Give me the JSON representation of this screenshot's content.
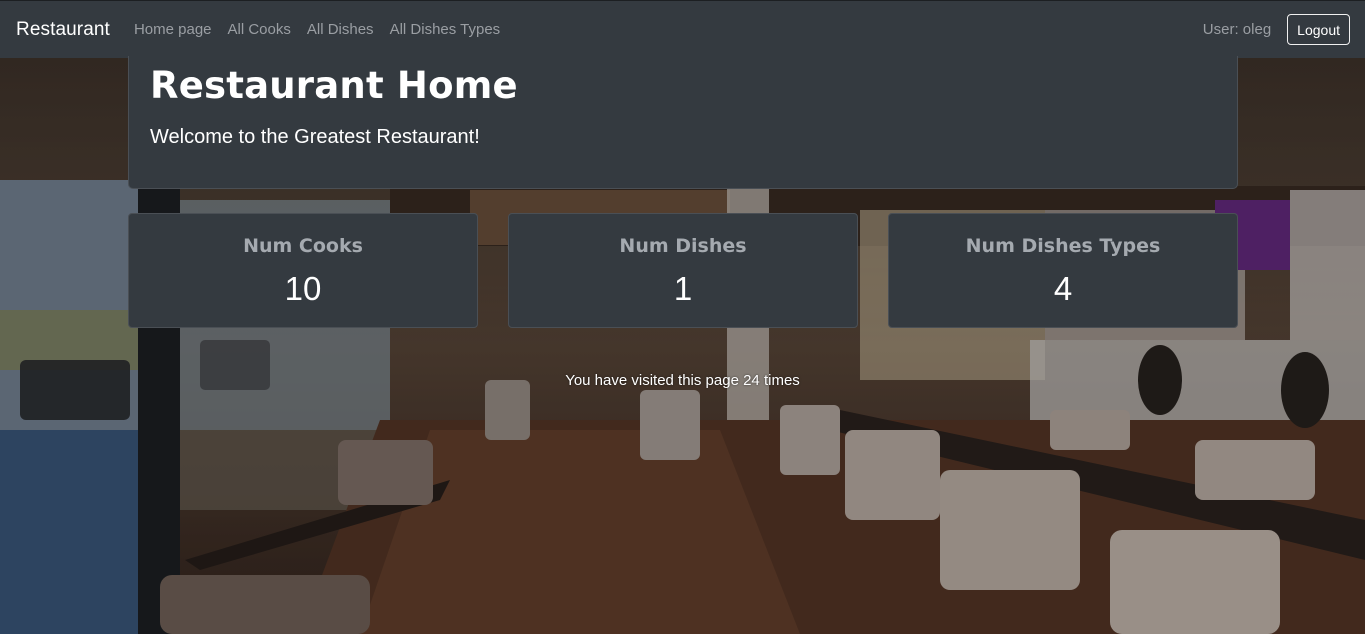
{
  "navbar": {
    "brand": "Restaurant",
    "links": [
      "Home page",
      "All Cooks",
      "All Dishes",
      "All Dishes Types"
    ],
    "user_label": "User: oleg",
    "logout_label": "Logout"
  },
  "hero": {
    "title": "Restaurant Home",
    "subtitle": "Welcome to the Greatest Restaurant!"
  },
  "stats": [
    {
      "title": "Num Cooks",
      "value": "10"
    },
    {
      "title": "Num Dishes",
      "value": "1"
    },
    {
      "title": "Num Dishes Types",
      "value": "4"
    }
  ],
  "visits_text": "You have visited this page 24 times",
  "colors": {
    "navbar_bg": "#343a40",
    "panel_bg": "#343a40",
    "muted_text": "#9a9ea3",
    "text": "#ffffff"
  }
}
